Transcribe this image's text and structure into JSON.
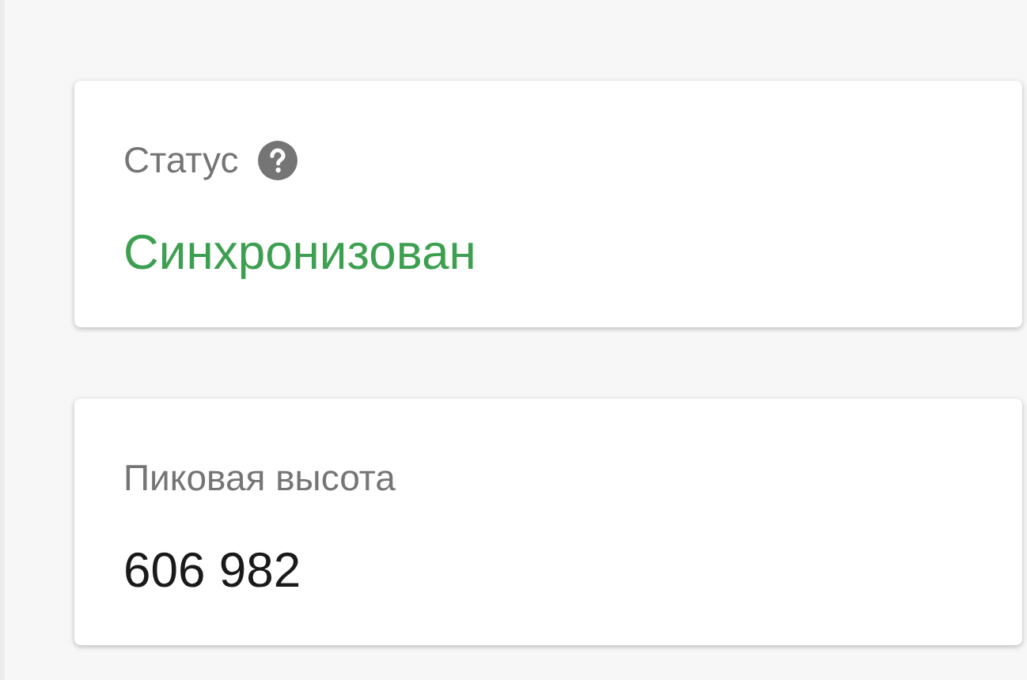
{
  "cards": [
    {
      "label": "Статус",
      "help": true,
      "value": "Синхронизован",
      "color": "#3da050"
    },
    {
      "label": "Пиковая высота",
      "help": false,
      "value": "606 982",
      "color": "#1a1a1a"
    }
  ]
}
